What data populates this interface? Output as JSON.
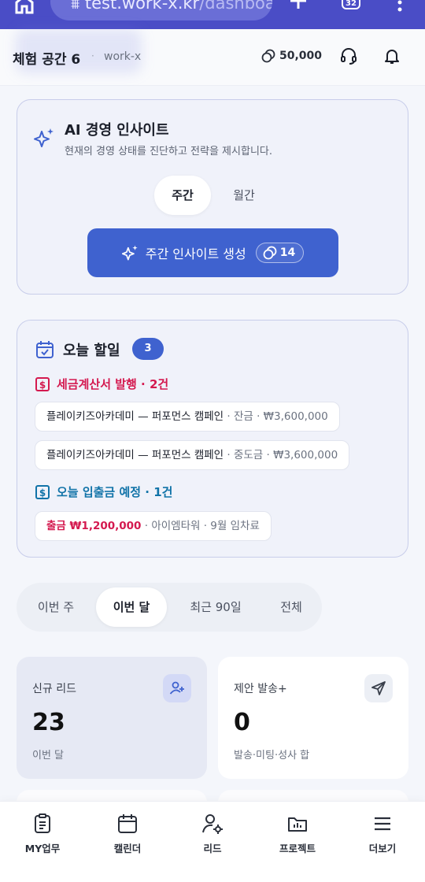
{
  "browser": {
    "url_main": "test.work-x.kr",
    "url_rest": "/dashboar",
    "tab_count": "32"
  },
  "header": {
    "workspace": "체험 공간 6",
    "separator": "·",
    "slug": "work-x",
    "credits": "50,000"
  },
  "ai_insight": {
    "title": "AI 경영 인사이트",
    "subtitle": "현재의 경영 상태를 진단하고 전략을 제시합니다.",
    "tabs": [
      "주간",
      "월간"
    ],
    "button_label": "주간 인사이트 생성",
    "button_cost": "14"
  },
  "todo": {
    "title": "오늘 할일",
    "count": "3",
    "tax_section": "세금계산서 발행 · 2건",
    "tax_items": [
      {
        "main": "플레이키즈아카데미 — 퍼포먼스 캠페인",
        "meta": " · 잔금 · ₩3,600,000"
      },
      {
        "main": "플레이키즈아카데미 — 퍼포먼스 캠페인",
        "meta": " · 중도금 · ₩3,600,000"
      }
    ],
    "cash_section": "오늘 입출금 예정 · 1건",
    "cash_items": [
      {
        "main": "출금 ₩1,200,000",
        "meta": " · 아이엠타워 · 9월 임차료"
      }
    ]
  },
  "period_tabs": [
    "이번 주",
    "이번 달",
    "최근 90일",
    "전체"
  ],
  "stats": [
    {
      "label": "신규 리드",
      "value": "23",
      "note": "이번 달",
      "icon": "user-plus-icon"
    },
    {
      "label": "제안 발송+",
      "value": "0",
      "note": "발송·미팅·성사 합",
      "icon": "send-icon"
    }
  ],
  "nav": [
    "MY업무",
    "캘린더",
    "리드",
    "프로젝트",
    "더보기"
  ],
  "colors": {
    "primary": "#3f62cf",
    "tax": "#d4194f",
    "cash": "#1173a8",
    "browser": "#4a4dc6"
  }
}
